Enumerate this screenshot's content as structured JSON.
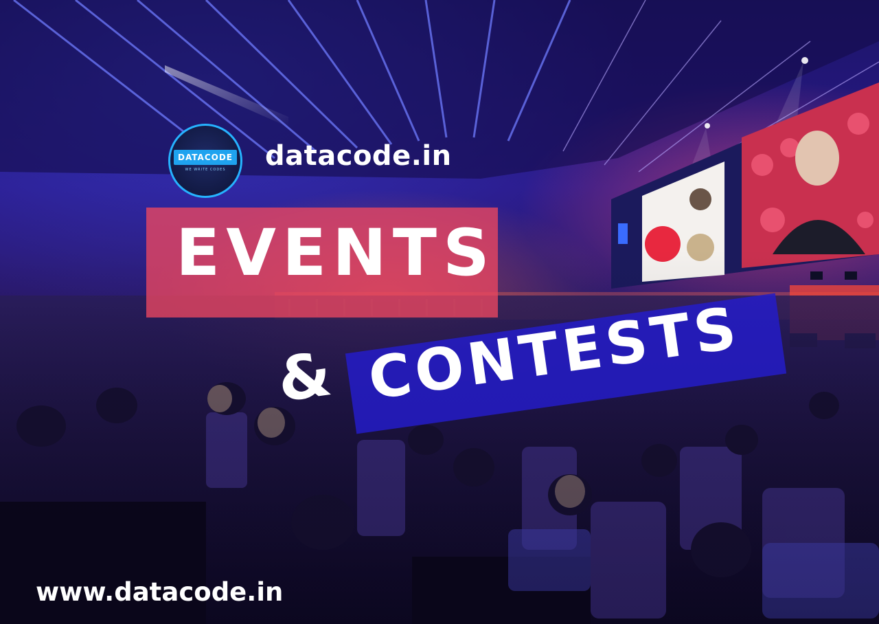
{
  "brand": {
    "logo_badge": "DATACODE",
    "logo_tagline": "WE WRITE CODES",
    "site_top": "datacode.in",
    "site_bottom": "www.datacode.in"
  },
  "headline": {
    "line1": "EVENTS",
    "ampersand": "&",
    "line2": "CONTESTS"
  },
  "colors": {
    "events_box": "#ec4660",
    "contests_box": "#241cc8",
    "logo_ring": "#26b3ff",
    "logo_badge": "#1fa3ef",
    "text": "#ffffff"
  },
  "icons": {
    "logo": "datacode-logo-icon"
  }
}
